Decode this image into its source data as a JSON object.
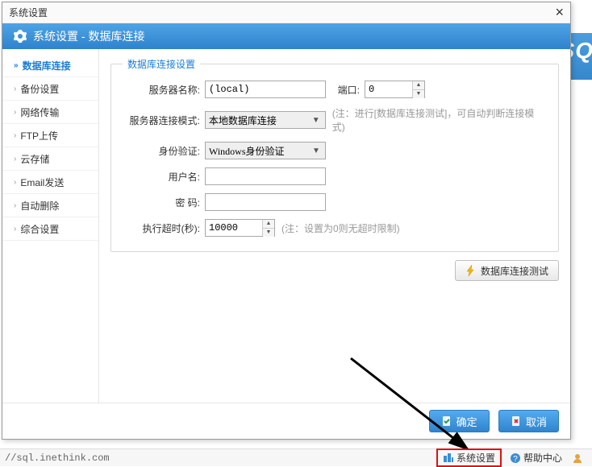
{
  "window_title": "系统设置",
  "header_title": "系统设置 - 数据库连接",
  "bg_text": "SQ",
  "sidebar": {
    "items": [
      {
        "label": "数据库连接",
        "active": true
      },
      {
        "label": "备份设置"
      },
      {
        "label": "网络传输"
      },
      {
        "label": "FTP上传"
      },
      {
        "label": "云存储"
      },
      {
        "label": "Email发送"
      },
      {
        "label": "自动删除"
      },
      {
        "label": "综合设置"
      }
    ]
  },
  "group": {
    "legend": "数据库连接设置",
    "server_label": "服务器名称:",
    "server_value": "(local)",
    "port_label": "端口:",
    "port_value": "0",
    "mode_label": "服务器连接模式:",
    "mode_value": "本地数据库连接",
    "mode_note": "(注：进行[数据库连接测试]，可自动判断连接模式)",
    "auth_label": "身份验证:",
    "auth_value": "Windows身份验证",
    "user_label": "用户名:",
    "user_value": "",
    "pass_label": "密 码:",
    "pass_value": "",
    "timeout_label": "执行超时(秒):",
    "timeout_value": "10000",
    "timeout_note": "(注：设置为0则无超时限制)",
    "test_btn": "数据库连接测试"
  },
  "buttons": {
    "ok": "确定",
    "cancel": "取消"
  },
  "statusbar": {
    "url": "//sql.inethink.com",
    "sys_settings": "系统设置",
    "help": "帮助中心"
  }
}
